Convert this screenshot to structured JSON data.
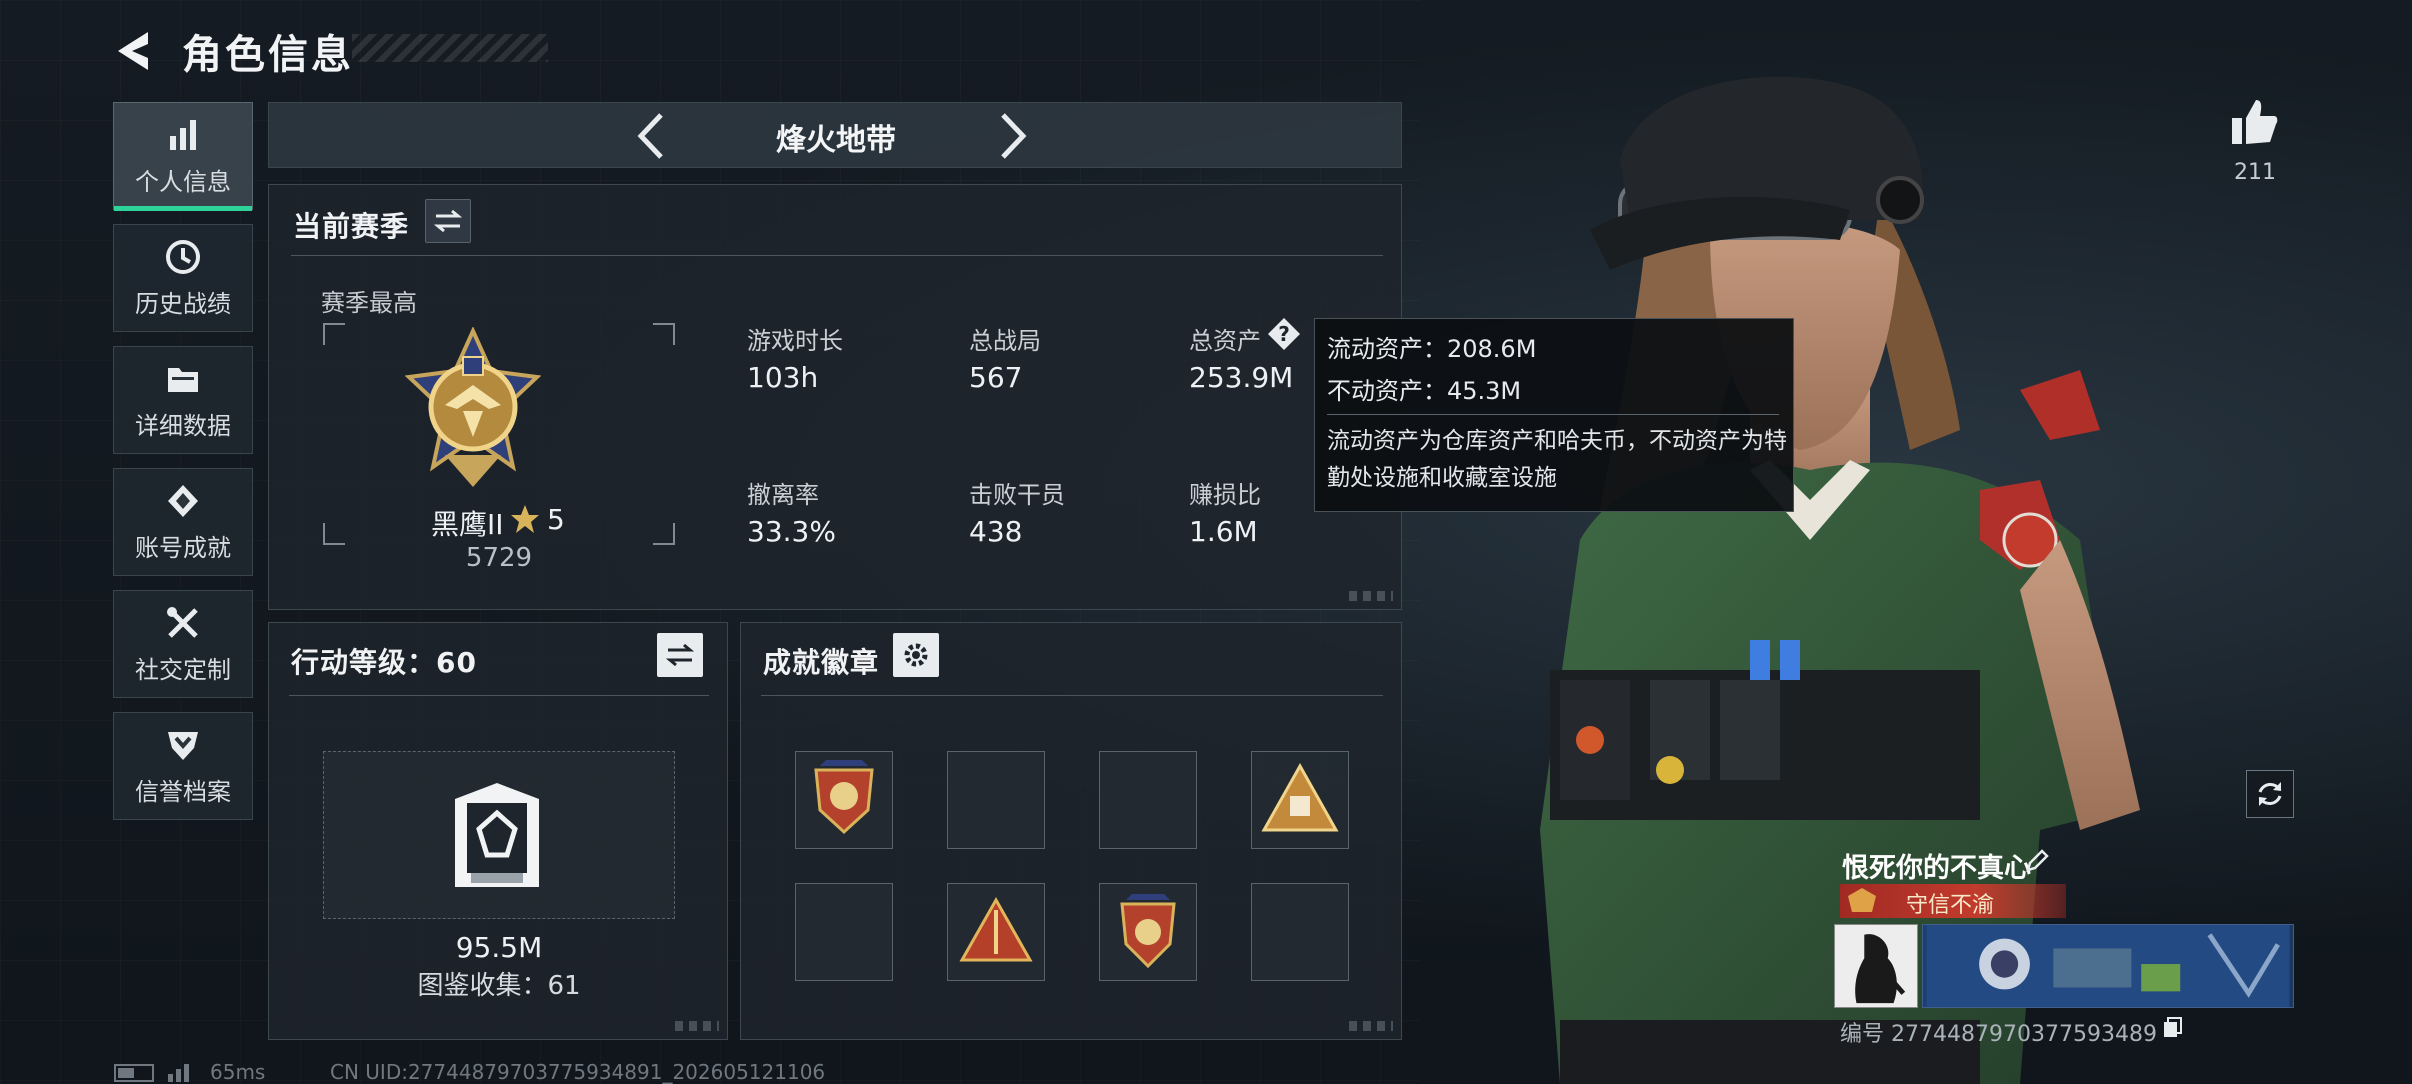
{
  "header": {
    "title": "角色信息"
  },
  "sidebar": {
    "items": [
      {
        "label": "个人信息",
        "icon": "bar-chart-icon",
        "active": true
      },
      {
        "label": "历史战绩",
        "icon": "history-clock-icon"
      },
      {
        "label": "详细数据",
        "icon": "folder-icon"
      },
      {
        "label": "账号成就",
        "icon": "achievement-icon"
      },
      {
        "label": "社交定制",
        "icon": "tools-icon"
      },
      {
        "label": "信誉档案",
        "icon": "shield-rank-icon"
      }
    ]
  },
  "mode": {
    "label": "烽火地带"
  },
  "season": {
    "title": "当前赛季",
    "best_label": "赛季最高",
    "rank_name": "黑鹰II",
    "rank_stars": "5",
    "rank_score": "5729",
    "stats": [
      {
        "label": "游戏时长",
        "value": "103h"
      },
      {
        "label": "总战局",
        "value": "567"
      },
      {
        "label": "总资产",
        "value": "253.9M"
      },
      {
        "label": "撤离率",
        "value": "33.3%"
      },
      {
        "label": "击败干员",
        "value": "438"
      },
      {
        "label": "赚损比",
        "value": "1.6M"
      }
    ]
  },
  "tooltip": {
    "liquid": "流动资产：208.6M",
    "fixed": "不动资产：45.3M",
    "desc": "流动资产为仓库资产和哈夫币，不动资产为特勤处设施和收藏室设施"
  },
  "action": {
    "title": "行动等级：60",
    "value": "95.5M",
    "collection": "图鉴收集：61"
  },
  "badges": {
    "title": "成就徽章"
  },
  "likes": {
    "count": "211"
  },
  "player": {
    "name": "恨死你的不真心",
    "title": "守信不渝",
    "id": "编号 2774487970377593489"
  },
  "status": {
    "ping": "65ms",
    "uid": "CN UID:27744879703775934891_202605121106"
  },
  "colors": {
    "accent": "#2ed39a",
    "title_badge": "#c23b2d",
    "panel": "#1e252c"
  }
}
